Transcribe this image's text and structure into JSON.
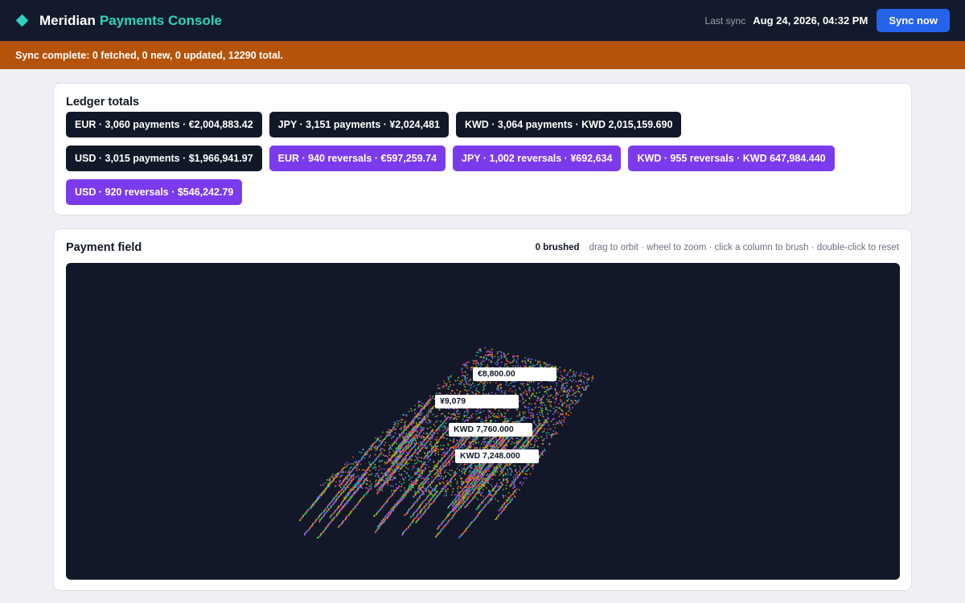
{
  "app": {
    "brand_name": "Meridian",
    "brand_subtitle": "Payments Console",
    "last_sync_label": "Last sync",
    "last_sync_time": "Aug 24, 2026, 04:32 PM",
    "sync_button": "Sync now",
    "brand_icon": "diamond-icon"
  },
  "banner": {
    "message": "Sync complete: 0 fetched, 0 new, 0 updated, 12290 total."
  },
  "ledger": {
    "title": "Ledger totals",
    "chips": [
      {
        "label": "EUR · 3,060 payments · €2,004,883.42",
        "kind": "payment"
      },
      {
        "label": "JPY · 3,151 payments · ¥2,024,481",
        "kind": "payment"
      },
      {
        "label": "KWD · 3,064 payments · KWD 2,015,159.690",
        "kind": "payment"
      },
      {
        "label": "USD · 3,015 payments · $1,966,941.97",
        "kind": "payment"
      },
      {
        "label": "EUR · 940 reversals · €597,259.74",
        "kind": "reversal"
      },
      {
        "label": "JPY · 1,002 reversals · ¥692,634",
        "kind": "reversal"
      },
      {
        "label": "KWD · 955 reversals · KWD 647,984.440",
        "kind": "reversal"
      },
      {
        "label": "USD · 920 reversals · $546,242.79",
        "kind": "reversal"
      }
    ]
  },
  "field": {
    "title": "Payment field",
    "brushed": "0 brushed",
    "hint": "drag to orbit · wheel to zoom · click a column to brush · double-click to reset",
    "tags": [
      {
        "label": "€8,800.00"
      },
      {
        "label": "¥9,079"
      },
      {
        "label": "KWD 7,760.000"
      },
      {
        "label": "KWD 7,248.000"
      }
    ]
  },
  "colors": {
    "topbar": "#131a2b",
    "accent": "#2dd4bf",
    "banner": "#b45309",
    "payment_chip": "#111827",
    "reversal_chip": "#7c3aed",
    "button": "#2563eb",
    "canvas": "#121828"
  }
}
